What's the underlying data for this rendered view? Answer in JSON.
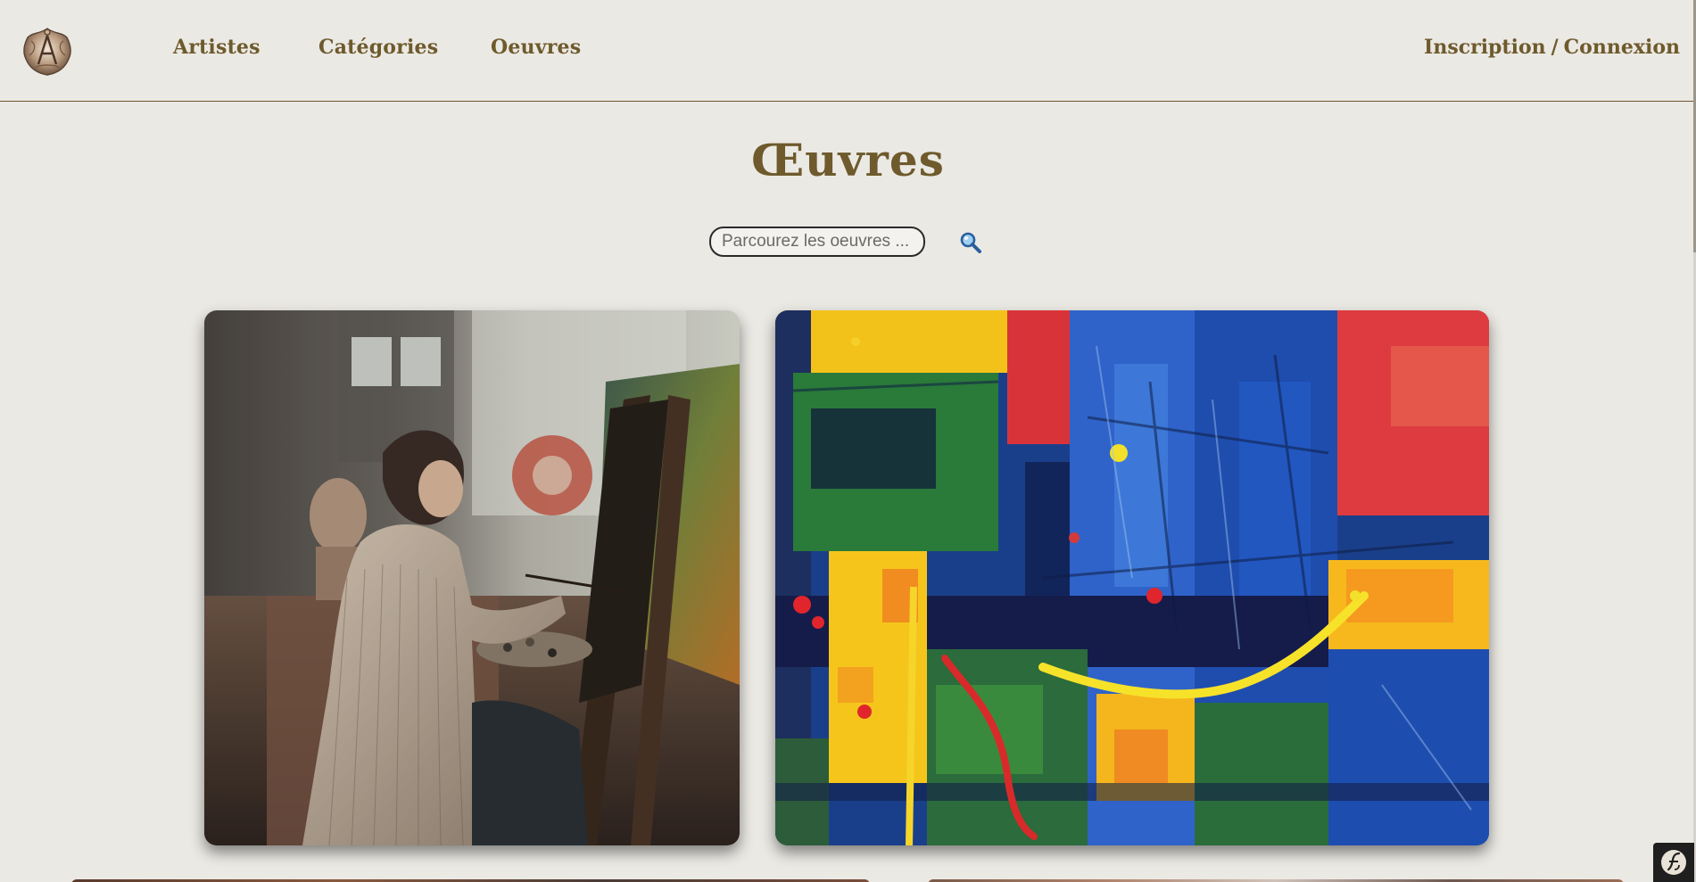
{
  "header": {
    "logo_alt": "logo",
    "nav": [
      {
        "label": "Artistes"
      },
      {
        "label": "Catégories"
      },
      {
        "label": "Oeuvres"
      }
    ],
    "auth": {
      "register_label": "Inscription",
      "separator": "/",
      "login_label": "Connexion"
    }
  },
  "main": {
    "title": "Œuvres",
    "search": {
      "placeholder": "Parcourez les oeuvres ...",
      "button_icon": "magnifier-icon"
    },
    "artworks": [
      {
        "image": "painter-at-easel-photo"
      },
      {
        "image": "abstract-colorful-painting"
      },
      {
        "image": "partial-artwork-3"
      },
      {
        "image": "partial-artwork-4"
      }
    ]
  },
  "debug_toolbar": {
    "icon": "symfony-icon"
  },
  "colors": {
    "background": "#EBE9E4",
    "accent": "#6E5A2C",
    "divider": "#6B5A2E"
  }
}
